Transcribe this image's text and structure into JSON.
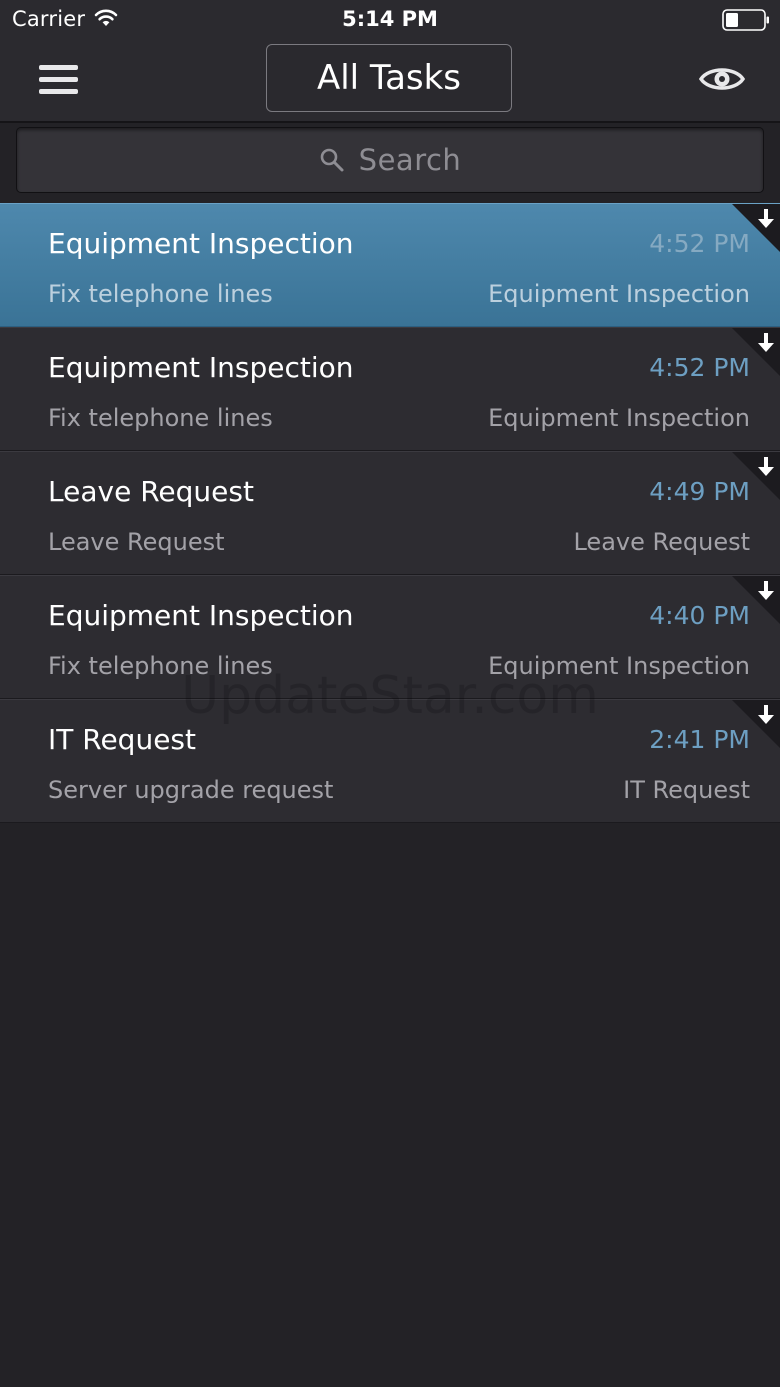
{
  "status_bar": {
    "carrier": "Carrier",
    "time": "5:14 PM"
  },
  "nav": {
    "title": "All Tasks",
    "menu_icon": "hamburger-menu-icon",
    "eye_icon": "eye-icon"
  },
  "search": {
    "placeholder": "Search",
    "icon": "search-icon"
  },
  "colors": {
    "background": "#232226",
    "row": "#2d2c31",
    "selected_row": "#3f7ea4",
    "time_text": "#6d9fc2"
  },
  "tasks": [
    {
      "title": "Equipment Inspection",
      "time": "4:52 PM",
      "subtitle": "Fix telephone lines",
      "category": "Equipment Inspection",
      "selected": true
    },
    {
      "title": "Equipment Inspection",
      "time": "4:52 PM",
      "subtitle": "Fix telephone lines",
      "category": "Equipment Inspection",
      "selected": false
    },
    {
      "title": "Leave Request",
      "time": "4:49 PM",
      "subtitle": "Leave Request",
      "category": "Leave Request",
      "selected": false
    },
    {
      "title": "Equipment Inspection",
      "time": "4:40 PM",
      "subtitle": "Fix telephone lines",
      "category": "Equipment Inspection",
      "selected": false
    },
    {
      "title": "IT Request",
      "time": "2:41 PM",
      "subtitle": "Server upgrade request",
      "category": "IT Request",
      "selected": false
    }
  ],
  "watermark": "UpdateStar.com"
}
